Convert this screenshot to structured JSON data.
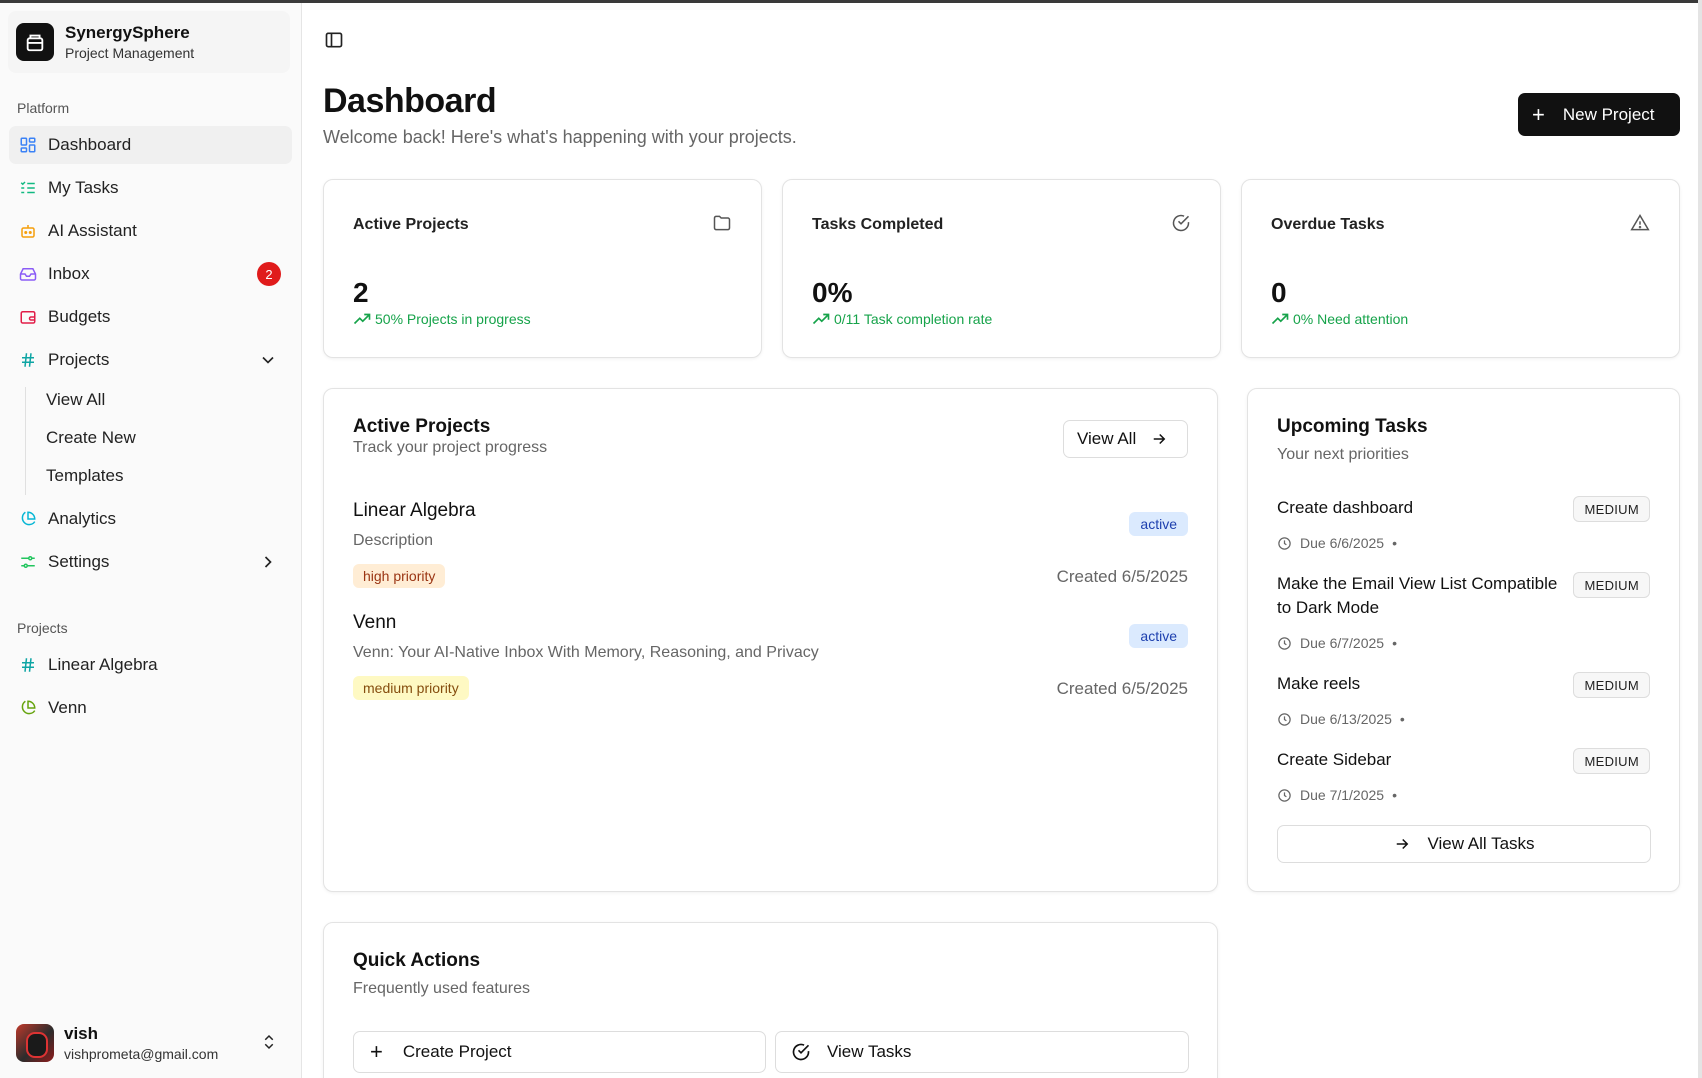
{
  "brand": {
    "name": "SynergySphere",
    "subtitle": "Project Management"
  },
  "sidebar": {
    "platform_label": "Platform",
    "items": [
      {
        "label": "Dashboard",
        "icon": "dashboard-icon"
      },
      {
        "label": "My Tasks",
        "icon": "tasks-list-icon"
      },
      {
        "label": "AI Assistant",
        "icon": "bot-icon"
      },
      {
        "label": "Inbox",
        "icon": "inbox-icon",
        "badge": "2"
      },
      {
        "label": "Budgets",
        "icon": "wallet-icon"
      },
      {
        "label": "Projects",
        "icon": "hash-icon"
      },
      {
        "label": "Analytics",
        "icon": "pie-chart-icon"
      },
      {
        "label": "Settings",
        "icon": "settings-sliders-icon"
      }
    ],
    "projects_sub": [
      "View All",
      "Create New",
      "Templates"
    ],
    "projects_label": "Projects",
    "projects": [
      {
        "label": "Linear Algebra",
        "icon": "hash-icon"
      },
      {
        "label": "Venn",
        "icon": "pie-chart-icon"
      }
    ],
    "user": {
      "name": "vish",
      "email": "vishprometa@gmail.com"
    }
  },
  "header": {
    "title": "Dashboard",
    "subtitle": "Welcome back! Here's what's happening with your projects.",
    "new_project_label": "New Project"
  },
  "stats": [
    {
      "title": "Active Projects",
      "value": "2",
      "trend": "50% Projects in progress",
      "icon": "folder-icon"
    },
    {
      "title": "Tasks Completed",
      "value": "0%",
      "trend": "0/11 Task completion rate",
      "icon": "check-circle-icon"
    },
    {
      "title": "Overdue Tasks",
      "value": "0",
      "trend": "0% Need attention",
      "icon": "alert-triangle-icon"
    }
  ],
  "active_projects": {
    "title": "Active Projects",
    "subtitle": "Track your project progress",
    "view_all_label": "View All",
    "projects": [
      {
        "name": "Linear Algebra",
        "description": "Description",
        "priority": "high priority",
        "status": "active",
        "created": "Created 6/5/2025"
      },
      {
        "name": "Venn",
        "description": "Venn: Your AI-Native Inbox With Memory, Reasoning, and Privacy",
        "priority": "medium priority",
        "status": "active",
        "created": "Created 6/5/2025"
      }
    ]
  },
  "upcoming_tasks": {
    "title": "Upcoming Tasks",
    "subtitle": "Your next priorities",
    "tasks": [
      {
        "title": "Create dashboard",
        "priority": "MEDIUM",
        "due": "Due 6/6/2025"
      },
      {
        "title": "Make the Email View List Compatible to Dark Mode",
        "priority": "MEDIUM",
        "due": "Due 6/7/2025"
      },
      {
        "title": "Make reels",
        "priority": "MEDIUM",
        "due": "Due 6/13/2025"
      },
      {
        "title": "Create Sidebar",
        "priority": "MEDIUM",
        "due": "Due 7/1/2025"
      }
    ],
    "view_all_label": "View All Tasks"
  },
  "quick_actions": {
    "title": "Quick Actions",
    "subtitle": "Frequently used features",
    "create_project_label": "Create Project",
    "view_tasks_label": "View Tasks"
  },
  "colors": {
    "trend_green": "#16a34a",
    "badge_red": "#e01b1b",
    "primary": "#111111"
  }
}
